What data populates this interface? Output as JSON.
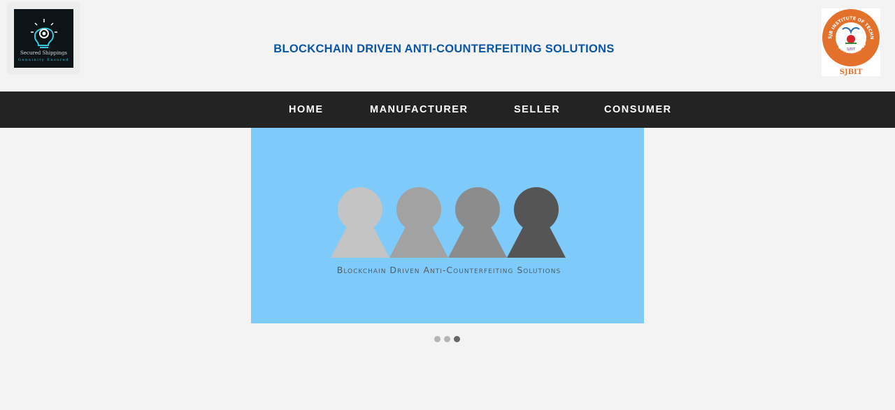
{
  "header": {
    "title": "BLOCKCHAIN DRIVEN ANTI-COUNTERFEITING SOLUTIONS",
    "left_logo": {
      "icon": "lightbulb-gear-icon",
      "brand_line1": "Secured Shippings",
      "brand_line2": "Genuinity Ensured",
      "accent": "#39c6e0"
    },
    "right_logo": {
      "ring_text": "SJB INSTITUTE OF TECHNOLOGY",
      "bottom_text": "BENGALURU-60",
      "center_text": "SJBIT",
      "label": "SJBIT",
      "accent": "#e3702b"
    }
  },
  "nav": {
    "items": [
      {
        "label": "HOME"
      },
      {
        "label": "MANUFACTURER"
      },
      {
        "label": "SELLER"
      },
      {
        "label": "CONSUMER"
      }
    ]
  },
  "slider": {
    "caption": "Blockchain Driven Anti-Counterfeiting Solutions",
    "background": "#7ecbfb",
    "figure_colors": [
      "#c4c4c4",
      "#a2a2a2",
      "#8c8c8c",
      "#555555"
    ],
    "dots": 3,
    "active_dot": 3
  },
  "colors": {
    "title_blue": "#0a56a6",
    "nav_bg": "#232323",
    "page_bg": "#f3f3f3"
  }
}
